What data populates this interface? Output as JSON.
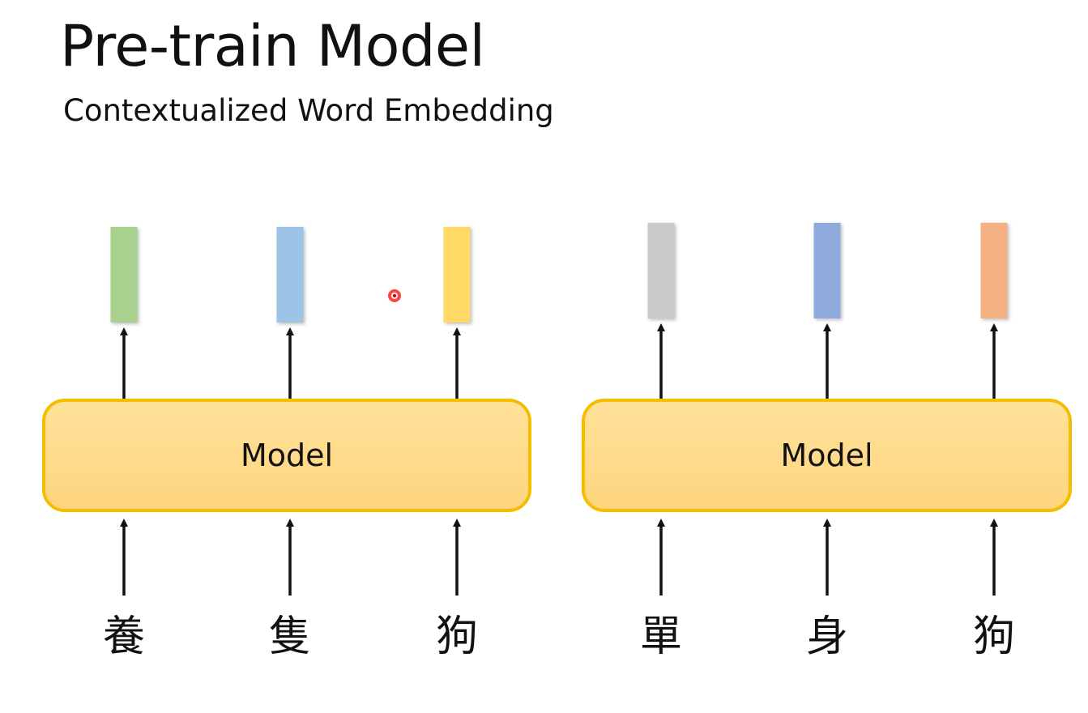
{
  "slide": {
    "title": "Pre-train Model",
    "subtitle": "Contextualized Word Embedding"
  },
  "diagram": {
    "groups": [
      {
        "model_label": "Model",
        "tokens": [
          {
            "label": "養",
            "vector_color": "#a9d18e"
          },
          {
            "label": "隻",
            "vector_color": "#9dc3e6"
          },
          {
            "label": "狗",
            "vector_color": "#ffd966"
          }
        ]
      },
      {
        "model_label": "Model",
        "tokens": [
          {
            "label": "單",
            "vector_color": "#c9c9c9"
          },
          {
            "label": "身",
            "vector_color": "#8faadc"
          },
          {
            "label": "狗",
            "vector_color": "#f4b183"
          }
        ]
      }
    ],
    "pointer_color": "#e00000"
  }
}
